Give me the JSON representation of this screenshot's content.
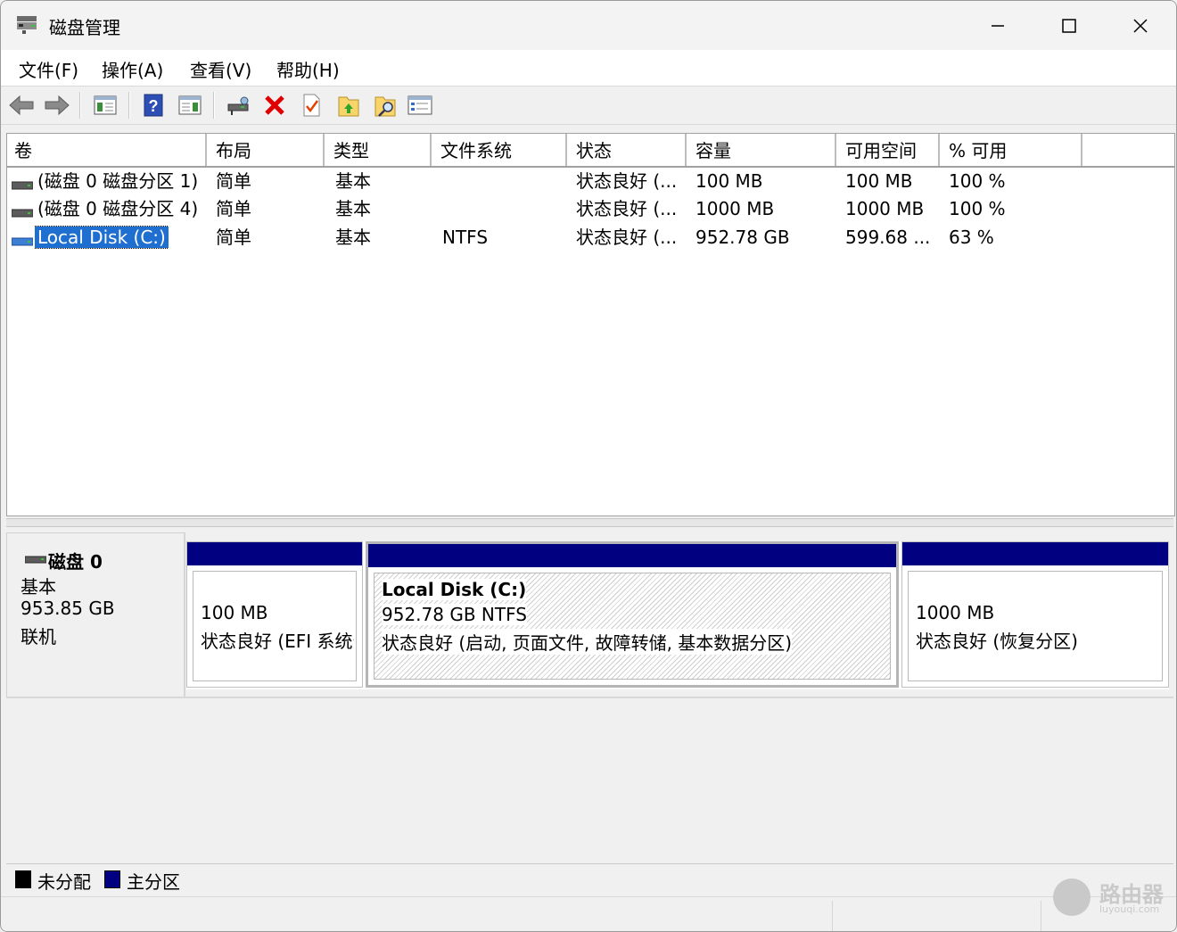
{
  "window": {
    "title": "磁盘管理"
  },
  "menu": [
    "文件(F)",
    "操作(A)",
    "查看(V)",
    "帮助(H)"
  ],
  "toolbar": [
    "back-icon",
    "forward-icon",
    "console-tree-icon",
    "help-icon",
    "action-pane-icon",
    "connect-disk-icon",
    "delete-icon",
    "checkmark-icon",
    "folder-up-icon",
    "search-icon",
    "properties-icon"
  ],
  "columns": [
    "卷",
    "布局",
    "类型",
    "文件系统",
    "状态",
    "容量",
    "可用空间",
    "% 可用"
  ],
  "volumes": [
    {
      "name": "(磁盘 0 磁盘分区 1)",
      "layout": "简单",
      "type": "基本",
      "fs": "",
      "status": "状态良好 (...",
      "capacity": "100 MB",
      "free": "100 MB",
      "pct": "100 %"
    },
    {
      "name": "(磁盘 0 磁盘分区 4)",
      "layout": "简单",
      "type": "基本",
      "fs": "",
      "status": "状态良好 (...",
      "capacity": "1000 MB",
      "free": "1000 MB",
      "pct": "100 %"
    },
    {
      "name": "Local Disk (C:)",
      "layout": "简单",
      "type": "基本",
      "fs": "NTFS",
      "status": "状态良好 (...",
      "capacity": "952.78 GB",
      "free": "599.68 ...",
      "pct": "63 %"
    }
  ],
  "disk": {
    "name": "磁盘 0",
    "kind": "基本",
    "size": "953.85 GB",
    "state": "联机"
  },
  "partitions": [
    {
      "line1": "100 MB",
      "line2": "状态良好 (EFI 系统分区)"
    },
    {
      "title": "Local Disk  (C:)",
      "line1": "952.78 GB NTFS",
      "line2": "状态良好 (启动, 页面文件, 故障转储, 基本数据分区)"
    },
    {
      "line1": "1000 MB",
      "line2": "状态良好 (恢复分区)"
    }
  ],
  "legend": [
    {
      "label": "未分配",
      "color": "#000000"
    },
    {
      "label": "主分区",
      "color": "#000080"
    }
  ],
  "watermark": {
    "text": "路由器",
    "sub": "luyouqi.com"
  }
}
